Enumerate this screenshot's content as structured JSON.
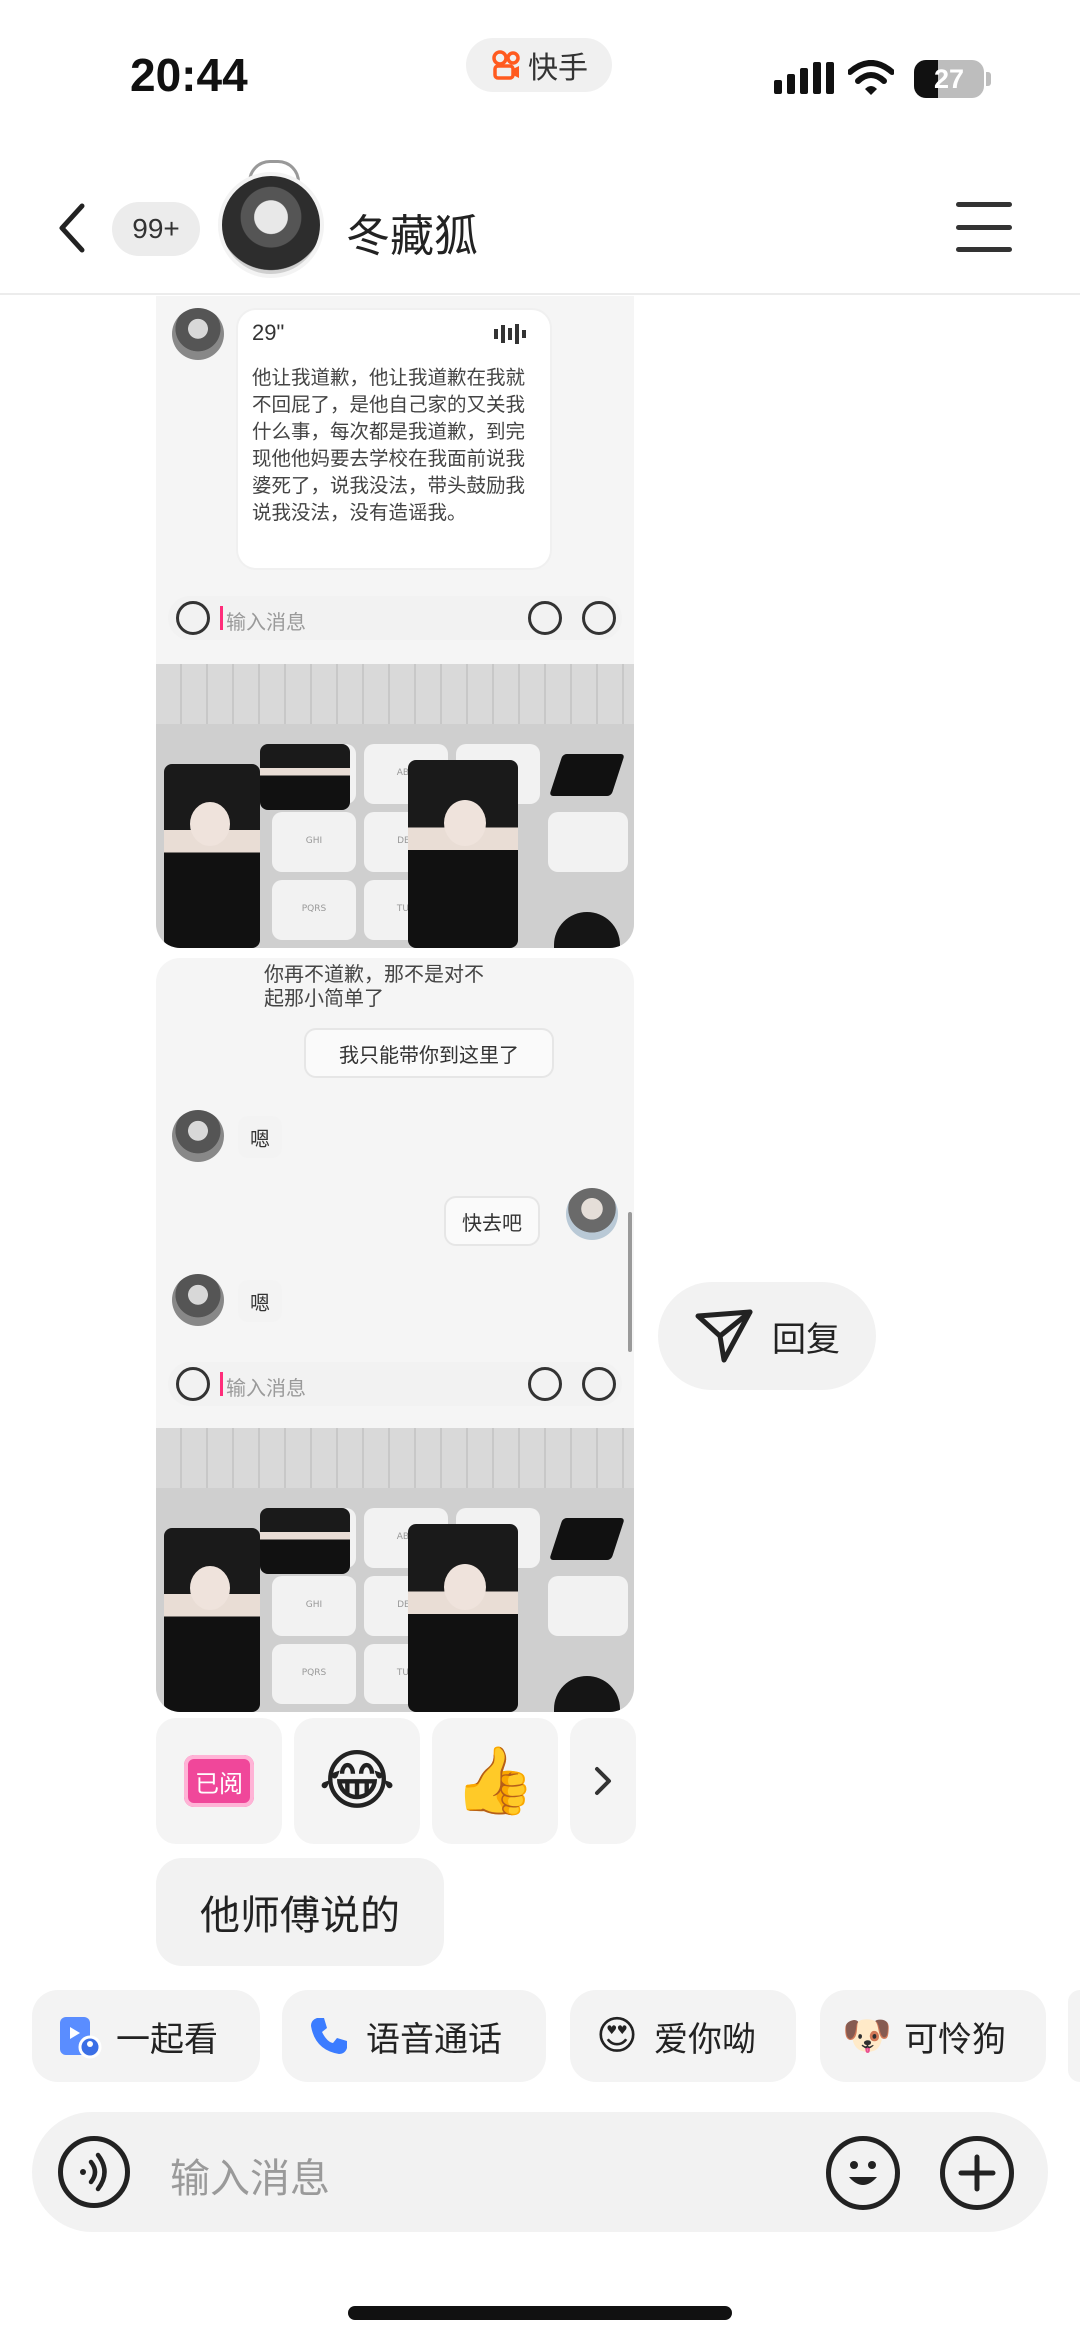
{
  "status_bar": {
    "time": "20:44",
    "app_name": "快手",
    "battery_level": "27",
    "icons": [
      "cellular-signal-icon",
      "wifi-icon",
      "battery-icon"
    ]
  },
  "header": {
    "unread_count": "99+",
    "contact_name": "冬藏狐",
    "icons": [
      "back-icon",
      "menu-icon"
    ]
  },
  "screenshot1": {
    "voice_duration": "29\"",
    "voice_transcript": "他让我道歉，他让我道歉在我就不回屁了，是他自己家的又关我什么事，每次都是我道歉，到完现他他妈要去学校在我面前说我婆死了，说我没法，带头鼓励我说我没法，没有造谣我。",
    "input_placeholder": "输入消息",
    "key_labels": [
      "ABC",
      "GHI",
      "DEF",
      "PQRS",
      "TUV"
    ]
  },
  "screenshot2": {
    "handwritten_line1": "你再不道歉，那不是对不",
    "handwritten_line2": "起那小简单了",
    "handwritten_line3": "我只能带你到这里了",
    "reply1": "嗯",
    "sent": "快去吧",
    "reply2": "嗯",
    "input_placeholder": "输入消息",
    "key_labels": [
      "ABC",
      "GHI",
      "DEF",
      "PQRS",
      "TUV"
    ]
  },
  "reply_button": {
    "label": "回复",
    "icon": "send-plane-icon"
  },
  "reactions": {
    "read_label": "已阅",
    "items": [
      "😂",
      "👍"
    ],
    "more_icon": "chevron-right-icon"
  },
  "message": {
    "text": "他师傅说的"
  },
  "quick_actions": [
    {
      "label": "一起看",
      "icon": "watch-together-icon"
    },
    {
      "label": "语音通话",
      "icon": "phone-icon"
    },
    {
      "label": "爱你呦",
      "emoji": "😍"
    },
    {
      "label": "可怜狗",
      "emoji": "🐶"
    }
  ],
  "input": {
    "placeholder": "输入消息",
    "icons": [
      "voice-icon",
      "emoji-icon",
      "plus-icon"
    ]
  },
  "colors": {
    "read_badge": "#f0479a",
    "phone_icon": "#3b7cff",
    "watch_icon": "#5a8dff"
  }
}
